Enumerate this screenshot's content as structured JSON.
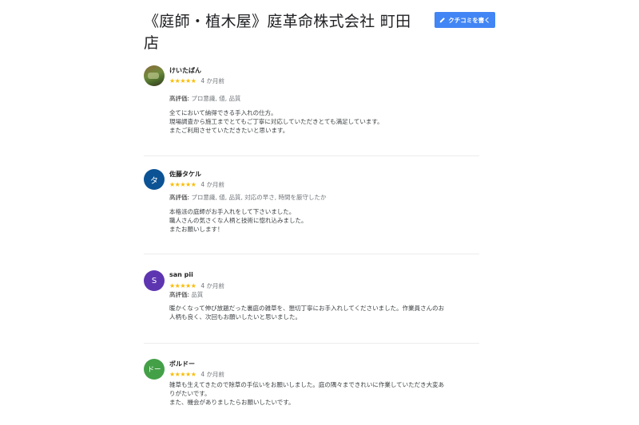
{
  "business_title": "《庭師・植木屋》庭革命株式会社 町田店",
  "write_review_label": "クチコミを書く",
  "highlights_label": "高評価:",
  "reviews": [
    {
      "name": "けいたぱん",
      "avatar_letter": "",
      "avatar_color": "#6e8a3d",
      "stars": "★★★★★",
      "date": "4 か月前",
      "highlights": "プロ意識, 値, 品質",
      "text": [
        "全てにおいて納得できる手入れの仕方。",
        "現場調査から施工までとてもご丁寧に対応していただきとても満足しています。",
        "またご利用させていただきたいと思います。"
      ]
    },
    {
      "name": "佐藤タケル",
      "avatar_letter": "タ",
      "avatar_color": "#0b5394",
      "stars": "★★★★★",
      "date": "4 か月前",
      "highlights": "プロ意識, 値, 品質, 対応の早さ, 時間を厳守したか",
      "text": [
        "本格派の庭師がお手入れをして下さいました。",
        "職人さんの気さくな人柄と技術に惚れ込みました。",
        "またお願いします！"
      ]
    },
    {
      "name": "san pii",
      "avatar_letter": "S",
      "avatar_color": "#5e35b1",
      "stars": "★★★★★",
      "date": "4 か月前",
      "highlights": "品質",
      "text": [
        "暖かくなって伸び放題だった裏庭の雑草を、懇切丁寧にお手入れしてくださいました。作業員さんのお",
        "人柄も良く、次回もお願いしたいと思いました。"
      ]
    },
    {
      "name": "ボルドー",
      "avatar_letter": "ドー",
      "avatar_color": "#43a047",
      "stars": "★★★★★",
      "date": "4 か月前",
      "highlights": "",
      "text": [
        "雑草も生えてきたので除草の手伝いをお願いしました。庭の隅々まできれいに作業していただき大変あ",
        "りがたいです。",
        "また、機会がありましたらお願いしたいです。"
      ]
    }
  ]
}
